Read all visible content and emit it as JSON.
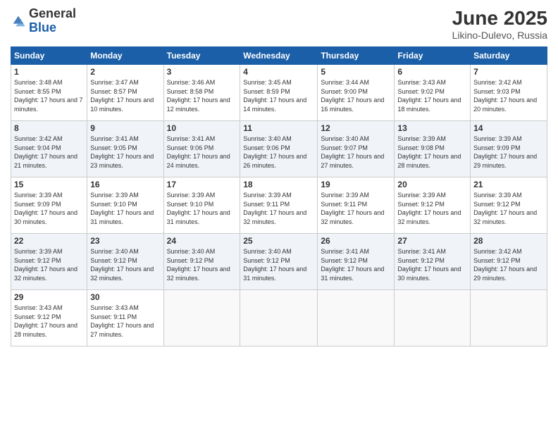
{
  "logo": {
    "general": "General",
    "blue": "Blue"
  },
  "header": {
    "month": "June 2025",
    "location": "Likino-Dulevo, Russia"
  },
  "weekdays": [
    "Sunday",
    "Monday",
    "Tuesday",
    "Wednesday",
    "Thursday",
    "Friday",
    "Saturday"
  ],
  "weeks": [
    [
      {
        "day": "1",
        "sunrise": "3:48 AM",
        "sunset": "8:55 PM",
        "daylight": "17 hours and 7 minutes."
      },
      {
        "day": "2",
        "sunrise": "3:47 AM",
        "sunset": "8:57 PM",
        "daylight": "17 hours and 10 minutes."
      },
      {
        "day": "3",
        "sunrise": "3:46 AM",
        "sunset": "8:58 PM",
        "daylight": "17 hours and 12 minutes."
      },
      {
        "day": "4",
        "sunrise": "3:45 AM",
        "sunset": "8:59 PM",
        "daylight": "17 hours and 14 minutes."
      },
      {
        "day": "5",
        "sunrise": "3:44 AM",
        "sunset": "9:00 PM",
        "daylight": "17 hours and 16 minutes."
      },
      {
        "day": "6",
        "sunrise": "3:43 AM",
        "sunset": "9:02 PM",
        "daylight": "17 hours and 18 minutes."
      },
      {
        "day": "7",
        "sunrise": "3:42 AM",
        "sunset": "9:03 PM",
        "daylight": "17 hours and 20 minutes."
      }
    ],
    [
      {
        "day": "8",
        "sunrise": "3:42 AM",
        "sunset": "9:04 PM",
        "daylight": "17 hours and 21 minutes."
      },
      {
        "day": "9",
        "sunrise": "3:41 AM",
        "sunset": "9:05 PM",
        "daylight": "17 hours and 23 minutes."
      },
      {
        "day": "10",
        "sunrise": "3:41 AM",
        "sunset": "9:06 PM",
        "daylight": "17 hours and 24 minutes."
      },
      {
        "day": "11",
        "sunrise": "3:40 AM",
        "sunset": "9:06 PM",
        "daylight": "17 hours and 26 minutes."
      },
      {
        "day": "12",
        "sunrise": "3:40 AM",
        "sunset": "9:07 PM",
        "daylight": "17 hours and 27 minutes."
      },
      {
        "day": "13",
        "sunrise": "3:39 AM",
        "sunset": "9:08 PM",
        "daylight": "17 hours and 28 minutes."
      },
      {
        "day": "14",
        "sunrise": "3:39 AM",
        "sunset": "9:09 PM",
        "daylight": "17 hours and 29 minutes."
      }
    ],
    [
      {
        "day": "15",
        "sunrise": "3:39 AM",
        "sunset": "9:09 PM",
        "daylight": "17 hours and 30 minutes."
      },
      {
        "day": "16",
        "sunrise": "3:39 AM",
        "sunset": "9:10 PM",
        "daylight": "17 hours and 31 minutes."
      },
      {
        "day": "17",
        "sunrise": "3:39 AM",
        "sunset": "9:10 PM",
        "daylight": "17 hours and 31 minutes."
      },
      {
        "day": "18",
        "sunrise": "3:39 AM",
        "sunset": "9:11 PM",
        "daylight": "17 hours and 32 minutes."
      },
      {
        "day": "19",
        "sunrise": "3:39 AM",
        "sunset": "9:11 PM",
        "daylight": "17 hours and 32 minutes."
      },
      {
        "day": "20",
        "sunrise": "3:39 AM",
        "sunset": "9:12 PM",
        "daylight": "17 hours and 32 minutes."
      },
      {
        "day": "21",
        "sunrise": "3:39 AM",
        "sunset": "9:12 PM",
        "daylight": "17 hours and 32 minutes."
      }
    ],
    [
      {
        "day": "22",
        "sunrise": "3:39 AM",
        "sunset": "9:12 PM",
        "daylight": "17 hours and 32 minutes."
      },
      {
        "day": "23",
        "sunrise": "3:40 AM",
        "sunset": "9:12 PM",
        "daylight": "17 hours and 32 minutes."
      },
      {
        "day": "24",
        "sunrise": "3:40 AM",
        "sunset": "9:12 PM",
        "daylight": "17 hours and 32 minutes."
      },
      {
        "day": "25",
        "sunrise": "3:40 AM",
        "sunset": "9:12 PM",
        "daylight": "17 hours and 31 minutes."
      },
      {
        "day": "26",
        "sunrise": "3:41 AM",
        "sunset": "9:12 PM",
        "daylight": "17 hours and 31 minutes."
      },
      {
        "day": "27",
        "sunrise": "3:41 AM",
        "sunset": "9:12 PM",
        "daylight": "17 hours and 30 minutes."
      },
      {
        "day": "28",
        "sunrise": "3:42 AM",
        "sunset": "9:12 PM",
        "daylight": "17 hours and 29 minutes."
      }
    ],
    [
      {
        "day": "29",
        "sunrise": "3:43 AM",
        "sunset": "9:12 PM",
        "daylight": "17 hours and 28 minutes."
      },
      {
        "day": "30",
        "sunrise": "3:43 AM",
        "sunset": "9:11 PM",
        "daylight": "17 hours and 27 minutes."
      },
      null,
      null,
      null,
      null,
      null
    ]
  ]
}
